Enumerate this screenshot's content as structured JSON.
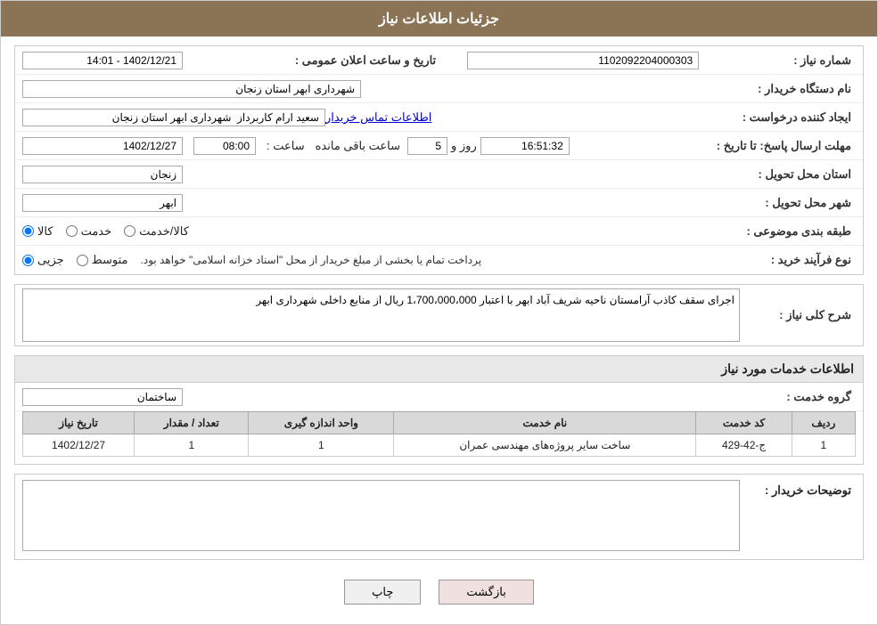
{
  "header": {
    "title": "جزئیات اطلاعات نیاز"
  },
  "form": {
    "need_number_label": "شماره نیاز :",
    "need_number_value": "1102092204000303",
    "buyer_label": "نام دستگاه خریدار :",
    "buyer_value": "شهرداری ابهر استان زنجان",
    "creator_label": "ایجاد کننده درخواست :",
    "creator_value": "سعید ارام کاربرداز  شهرداری ابهر استان زنجان",
    "contact_link": "اطلاعات تماس خریدار",
    "deadline_label": "مهلت ارسال پاسخ: تا تاریخ :",
    "deadline_date": "1402/12/27",
    "deadline_time_label": "ساعت :",
    "deadline_time": "08:00",
    "remaining_day_label": "روز و",
    "remaining_days": "5",
    "remaining_time": "16:51:32",
    "remaining_suffix": "ساعت باقی مانده",
    "announce_label": "تاریخ و ساعت اعلان عمومی :",
    "announce_value": "1402/12/21 - 14:01",
    "province_label": "استان محل تحویل :",
    "province_value": "زنجان",
    "city_label": "شهر محل تحویل :",
    "city_value": "ابهر",
    "category_label": "طبقه بندی موضوعی :",
    "category_kala": "کالا",
    "category_khadamat": "خدمت",
    "category_kala_khadamat": "کالا/خدمت",
    "process_label": "نوع فرآیند خرید :",
    "process_jazei": "جزیی",
    "process_mutavasset": "متوسط",
    "process_desc": "پرداخت تمام یا بخشی از مبلغ خریدار از محل \"اسناد خزانه اسلامی\" خواهد بود.",
    "need_desc_label": "شرح کلی نیاز :",
    "need_desc_value": "اجرای سقف کاذب آرامستان ناحیه شریف آباد ابهر با اعتبار 1،700،000،000 ریال از منابع داخلی شهرداری ابهر",
    "services_section_title": "اطلاعات خدمات مورد نیاز",
    "group_service_label": "گروه خدمت :",
    "group_service_value": "ساختمان",
    "table_headers": {
      "row_num": "ردیف",
      "service_code": "کد خدمت",
      "service_name": "نام خدمت",
      "unit": "واحد اندازه گیری",
      "quantity": "تعداد / مقدار",
      "need_date": "تاریخ نیاز"
    },
    "table_rows": [
      {
        "row_num": "1",
        "service_code": "ج-42-429",
        "service_name": "ساخت سایر پروژه‌های مهندسی عمران",
        "unit": "1",
        "quantity": "1",
        "need_date": "1402/12/27"
      }
    ],
    "buyer_notes_label": "توضیحات خریدار :",
    "buyer_notes_value": ""
  },
  "buttons": {
    "print_label": "چاپ",
    "back_label": "بازگشت"
  }
}
